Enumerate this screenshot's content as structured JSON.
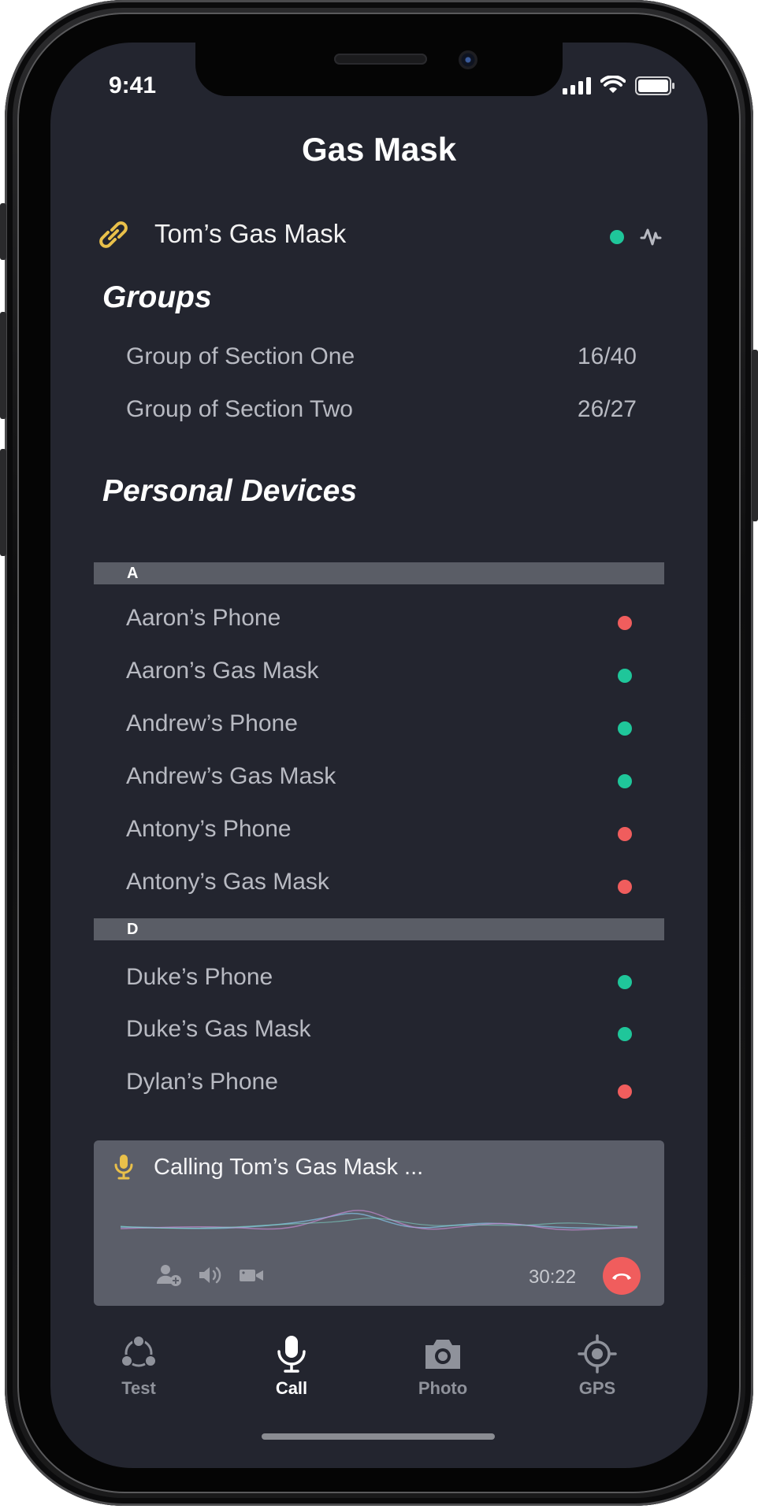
{
  "status_bar": {
    "time": "9:41"
  },
  "header": {
    "title": "Gas Mask"
  },
  "connected_device": {
    "name": "Tom’s Gas Mask",
    "status_color": "#1fc69a"
  },
  "groups": {
    "heading": "Groups",
    "items": [
      {
        "label": "Group of Section One",
        "count": "16/40"
      },
      {
        "label": "Group of Section Two",
        "count": "26/27"
      }
    ]
  },
  "personal_devices": {
    "heading": "Personal Devices",
    "sections": [
      {
        "letter": "A",
        "items": [
          {
            "label": "Aaron’s Phone",
            "status": "offline"
          },
          {
            "label": "Aaron’s Gas Mask",
            "status": "online"
          },
          {
            "label": "Andrew’s Phone",
            "status": "online"
          },
          {
            "label": "Andrew’s Gas Mask",
            "status": "online"
          },
          {
            "label": "Antony’s Phone",
            "status": "offline"
          },
          {
            "label": "Antony’s Gas Mask",
            "status": "offline"
          }
        ]
      },
      {
        "letter": "D",
        "items": [
          {
            "label": "Duke’s Phone",
            "status": "online"
          },
          {
            "label": "Duke’s Gas Mask",
            "status": "online"
          },
          {
            "label": "Dylan’s Phone",
            "status": "offline"
          }
        ]
      }
    ]
  },
  "call": {
    "calling_text": "Calling Tom’s Gas Mask ...",
    "timer": "30:22",
    "controls": [
      "add-user-icon",
      "speaker-icon",
      "video-icon",
      "hang-up-icon"
    ]
  },
  "tab_bar": {
    "items": [
      {
        "label": "Test",
        "icon": "test-icon",
        "active": false
      },
      {
        "label": "Call",
        "icon": "microphone-icon",
        "active": true
      },
      {
        "label": "Photo",
        "icon": "camera-icon",
        "active": false
      },
      {
        "label": "GPS",
        "icon": "gps-icon",
        "active": false
      }
    ]
  },
  "colors": {
    "background": "#23252f",
    "online": "#1fc69a",
    "offline": "#f05d5d",
    "accent_yellow": "#e9c04a",
    "section_bar": "#5a5d66",
    "call_panel": "#5b5e69"
  }
}
